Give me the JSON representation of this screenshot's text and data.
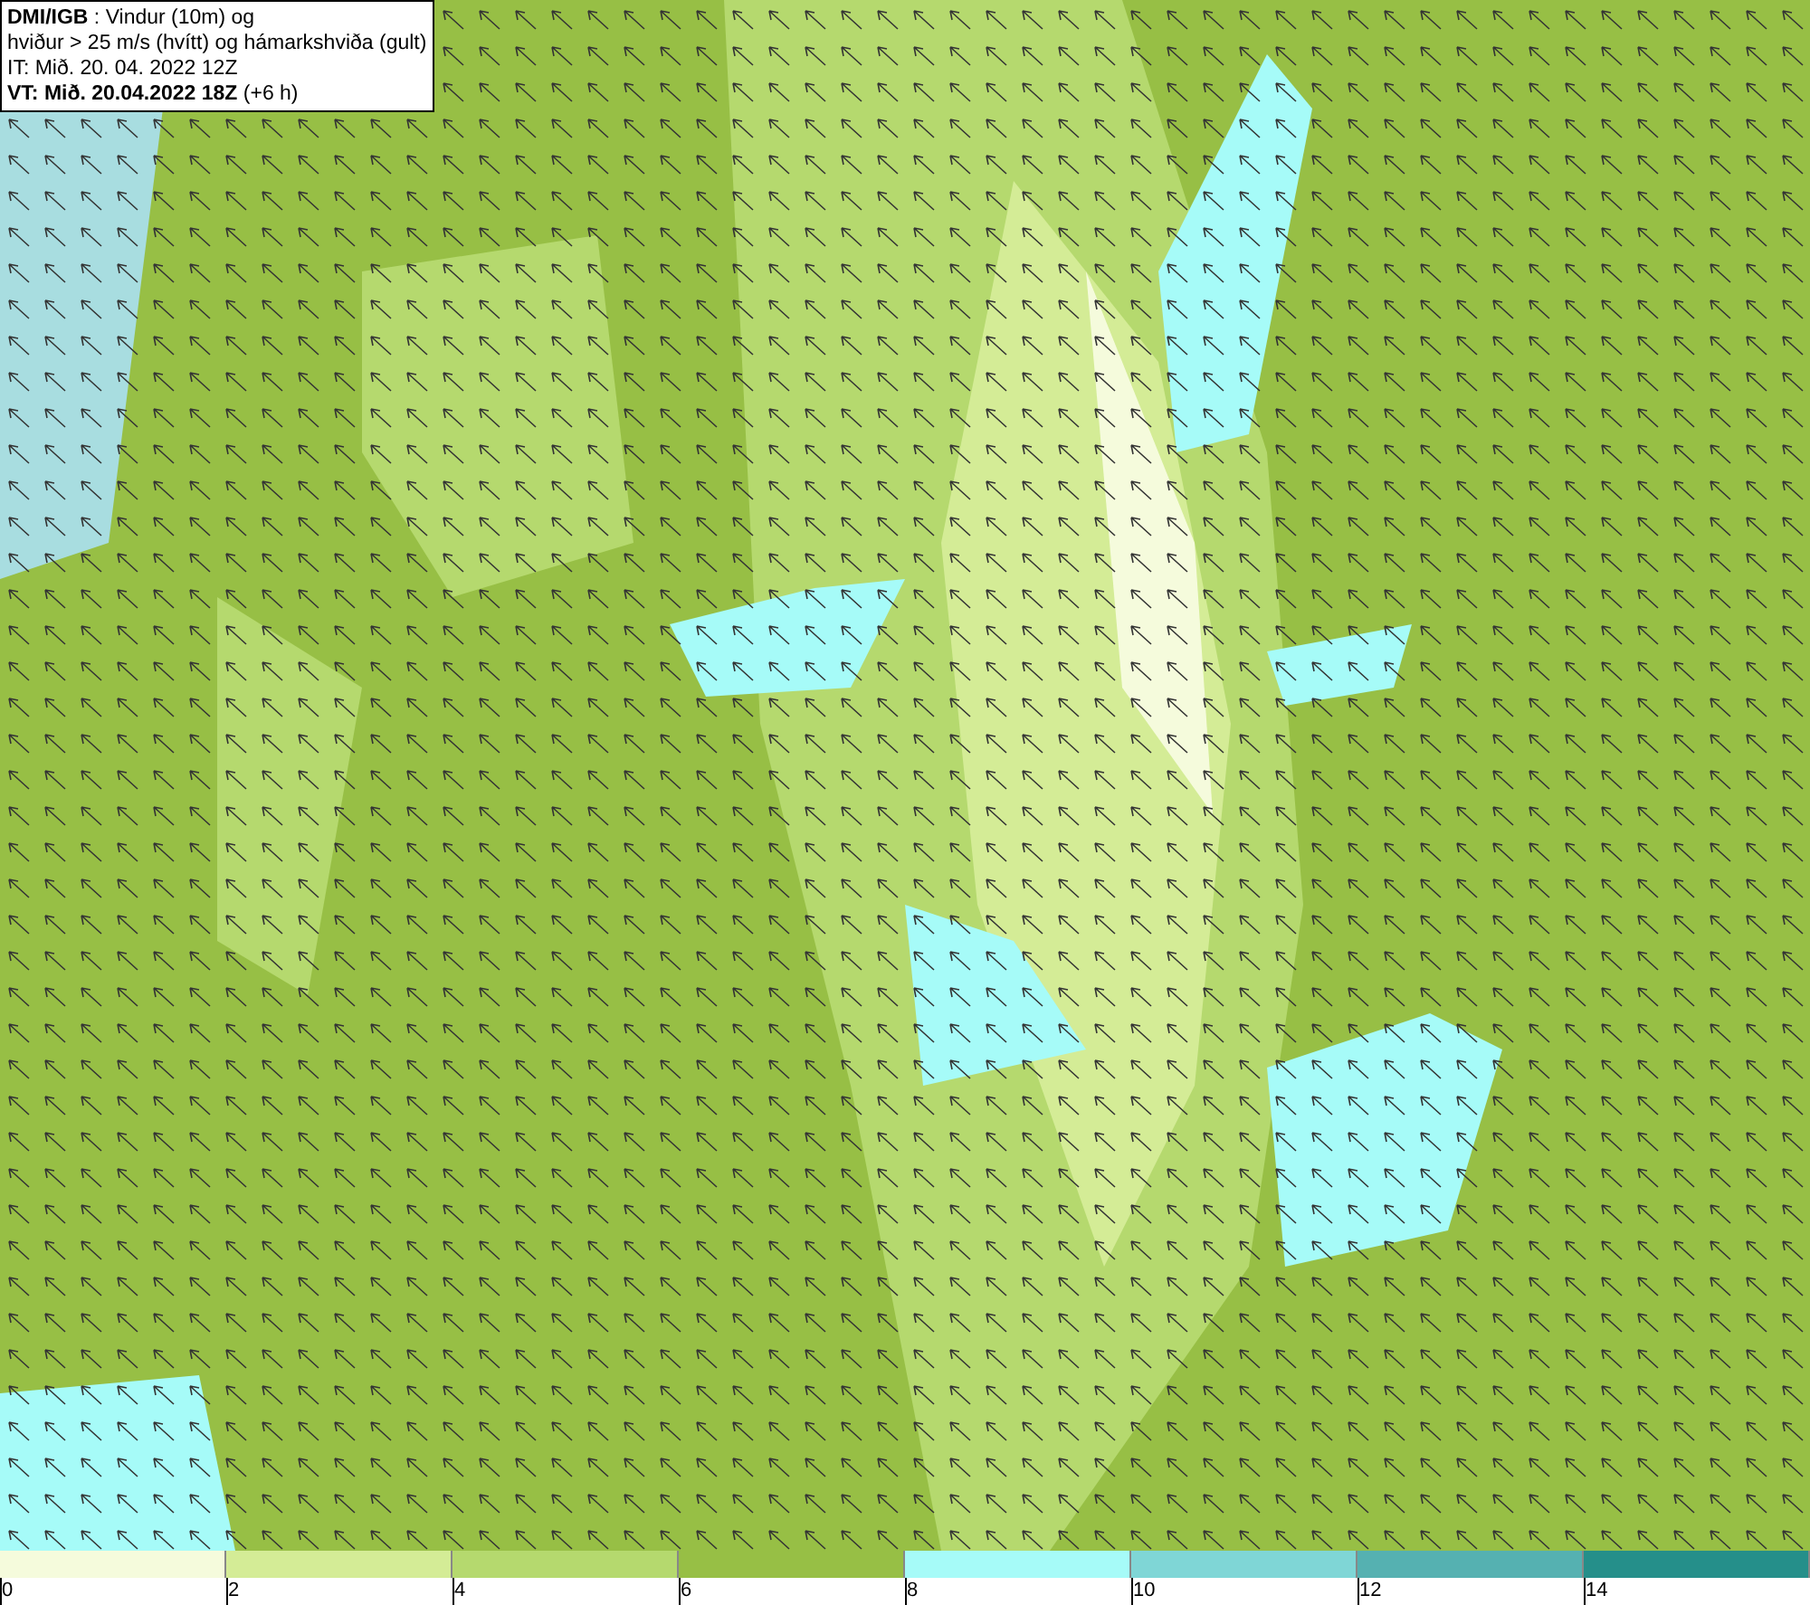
{
  "info_box": {
    "lines": [
      "**DMI/IGB** : Vindur (10m) og",
      "hviður > 25 m/s (hvítt) og hámarkshviða (gult)",
      "IT: Mið. 20. 04. 2022 12Z",
      "**VT: Mið. 20.04.2022 18Z** (+6 h)"
    ]
  },
  "legend": {
    "bins": [
      {
        "color": "#f5fbdc"
      },
      {
        "color": "#d4ec96"
      },
      {
        "color": "#b5d96e"
      },
      {
        "color": "#97bf45"
      },
      {
        "color": "#a6fbf8"
      },
      {
        "color": "#7fd6d6"
      },
      {
        "color": "#55b1b1"
      },
      {
        "color": "#258f8a"
      }
    ],
    "ticks": [
      "0",
      "2",
      "4",
      "6",
      "8",
      "10",
      "12",
      "14"
    ]
  }
}
